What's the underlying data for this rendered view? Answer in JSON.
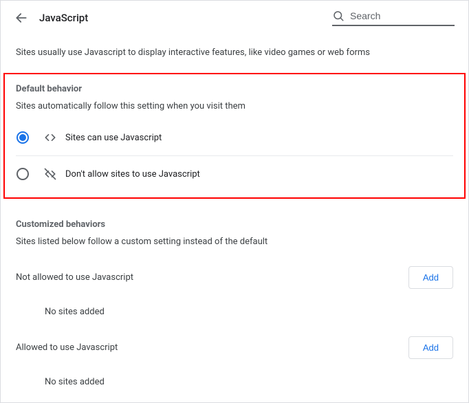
{
  "header": {
    "title": "JavaScript",
    "search_placeholder": "Search"
  },
  "intro": "Sites usually use Javascript to display interactive features, like video games or web forms",
  "default_behavior": {
    "heading": "Default behavior",
    "sub": "Sites automatically follow this setting when you visit them",
    "options": [
      {
        "label": "Sites can use Javascript",
        "selected": true
      },
      {
        "label": "Don't allow sites to use Javascript",
        "selected": false
      }
    ]
  },
  "custom": {
    "heading": "Customized behaviors",
    "sub": "Sites listed below follow a custom setting instead of the default",
    "blocked": {
      "title": "Not allowed to use Javascript",
      "add_label": "Add",
      "empty": "No sites added"
    },
    "allowed": {
      "title": "Allowed to use Javascript",
      "add_label": "Add",
      "empty": "No sites added"
    }
  }
}
